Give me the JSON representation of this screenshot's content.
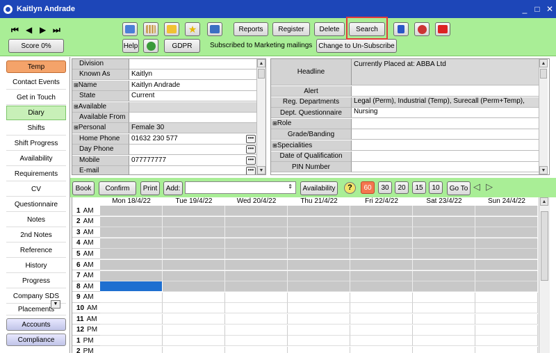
{
  "window": {
    "title": "Kaitlyn Andrade",
    "controls": [
      "_",
      "□",
      "✕"
    ]
  },
  "toolbar": {
    "nav": [
      "⏮",
      "◀",
      "▶",
      "⏭"
    ],
    "score": "Score 0%",
    "reports": "Reports",
    "register": "Register",
    "delete": "Delete",
    "search": "Search",
    "help": "Help",
    "gdpr": "GDPR",
    "subscribed_text": "Subscribed to Marketing mailings",
    "unsubscribe": "Change to Un-Subscribe"
  },
  "sidebar": {
    "temp_tab": "Temp",
    "items": [
      "Contact Events",
      "Get in Touch",
      "Diary",
      "Shifts",
      "Shift Progress",
      "Availability",
      "Requirements",
      "CV",
      "Questionnaire",
      "Notes",
      "2nd Notes",
      "Reference",
      "History",
      "Progress",
      "Company SDS",
      "Placements"
    ],
    "accounts_tab": "Accounts",
    "compliance_tab": "Compliance"
  },
  "details": {
    "rows": [
      {
        "label": "Division",
        "value": "",
        "expand": false,
        "dots": false
      },
      {
        "label": "Known As",
        "value": "Kaitlyn",
        "expand": false,
        "dots": false
      },
      {
        "label": "Name",
        "value": "Kaitlyn Andrade",
        "expand": true,
        "dots": false
      },
      {
        "label": "State",
        "value": "Current",
        "expand": false,
        "dots": false
      },
      {
        "label": "Available",
        "value": "",
        "expand": true,
        "dots": false,
        "grey": true
      },
      {
        "label": "Available From",
        "value": "",
        "expand": false,
        "dots": false
      },
      {
        "label": "Personal",
        "value": "Female 30",
        "expand": true,
        "dots": false,
        "grey": true
      },
      {
        "label": "Home Phone",
        "value": "01632 230 577",
        "expand": false,
        "dots": true
      },
      {
        "label": "Day Phone",
        "value": "",
        "expand": false,
        "dots": true
      },
      {
        "label": "Mobile",
        "value": "077777777",
        "expand": false,
        "dots": true
      },
      {
        "label": "E-mail",
        "value": "",
        "expand": false,
        "dots": true
      }
    ]
  },
  "profile": {
    "headline_label": "Headline",
    "headline_value": "Currently Placed at: ABBA Ltd",
    "rows": [
      {
        "label": "Alert",
        "value": ""
      },
      {
        "label": "Reg. Departments",
        "value": "Legal (Perm), Industrial (Temp), Surecall (Perm+Temp),",
        "grey": true
      },
      {
        "label": "Dept. Questionnaire",
        "value": "Nursing"
      },
      {
        "label": "Role",
        "value": "",
        "expand": true
      },
      {
        "label": "Grade/Banding",
        "value": ""
      },
      {
        "label": "Specialities",
        "value": "",
        "expand": true
      },
      {
        "label": "Date of Qualification",
        "value": ""
      },
      {
        "label": "PIN Number",
        "value": ""
      }
    ]
  },
  "diary": {
    "book": "Book",
    "confirm": "Confirm",
    "print": "Print",
    "add": "Add:",
    "availability": "Availability",
    "help_q": "?",
    "periods": [
      "60",
      "30",
      "20",
      "15",
      "10"
    ],
    "goto": "Go To",
    "days": [
      "Mon 18/4/22",
      "Tue 19/4/22",
      "Wed 20/4/22",
      "Thu 21/4/22",
      "Fri 22/4/22",
      "Sat 23/4/22",
      "Sun 24/4/22"
    ],
    "hours": [
      {
        "h": "1",
        "ap": "AM"
      },
      {
        "h": "2",
        "ap": "AM"
      },
      {
        "h": "3",
        "ap": "AM"
      },
      {
        "h": "4",
        "ap": "AM"
      },
      {
        "h": "5",
        "ap": "AM"
      },
      {
        "h": "6",
        "ap": "AM"
      },
      {
        "h": "7",
        "ap": "AM"
      },
      {
        "h": "8",
        "ap": "AM"
      },
      {
        "h": "9",
        "ap": "AM"
      },
      {
        "h": "10",
        "ap": "AM"
      },
      {
        "h": "11",
        "ap": "AM"
      },
      {
        "h": "12",
        "ap": "PM"
      },
      {
        "h": "1",
        "ap": "PM"
      },
      {
        "h": "2",
        "ap": "PM"
      }
    ],
    "grey_until_hour_index": 8
  }
}
